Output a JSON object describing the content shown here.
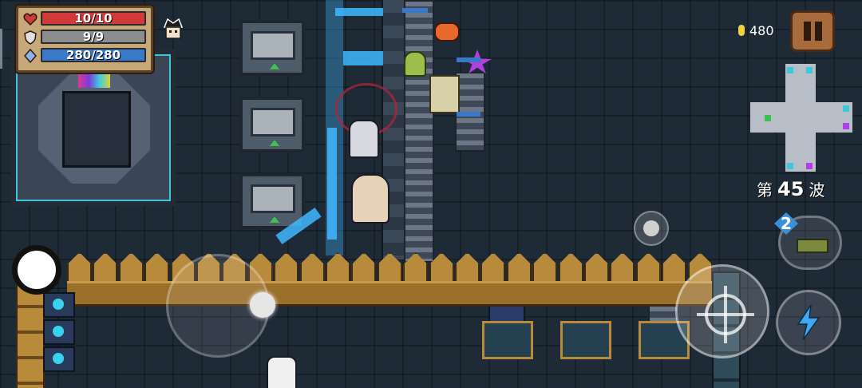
{
  "hud": {
    "hp": {
      "current": 10,
      "max": 10,
      "text": "10/10",
      "color": "#d03a3a"
    },
    "armor": {
      "current": 9,
      "max": 9,
      "text": "9/9",
      "color": "#8d8d8d"
    },
    "energy": {
      "current": 280,
      "max": 280,
      "text": "280/280",
      "color": "#3a78c8"
    },
    "gold": "480",
    "wave": {
      "prefix": "第",
      "number": "45",
      "suffix": "波"
    },
    "weapon_cost": "2"
  },
  "icons": {
    "hp": "heart-icon",
    "armor": "shield-icon",
    "energy": "energy-gem-icon",
    "gold": "coin-icon",
    "pause": "pause-icon",
    "attack": "crosshair-icon",
    "skill": "lightning-icon",
    "emote": "smiley-face-icon",
    "buff": "buff-hat-icon"
  },
  "colors": {
    "accent_cyan": "#3cc8d8",
    "fence_gold": "#b88a3b",
    "minimap_path": "#b7bec7"
  }
}
